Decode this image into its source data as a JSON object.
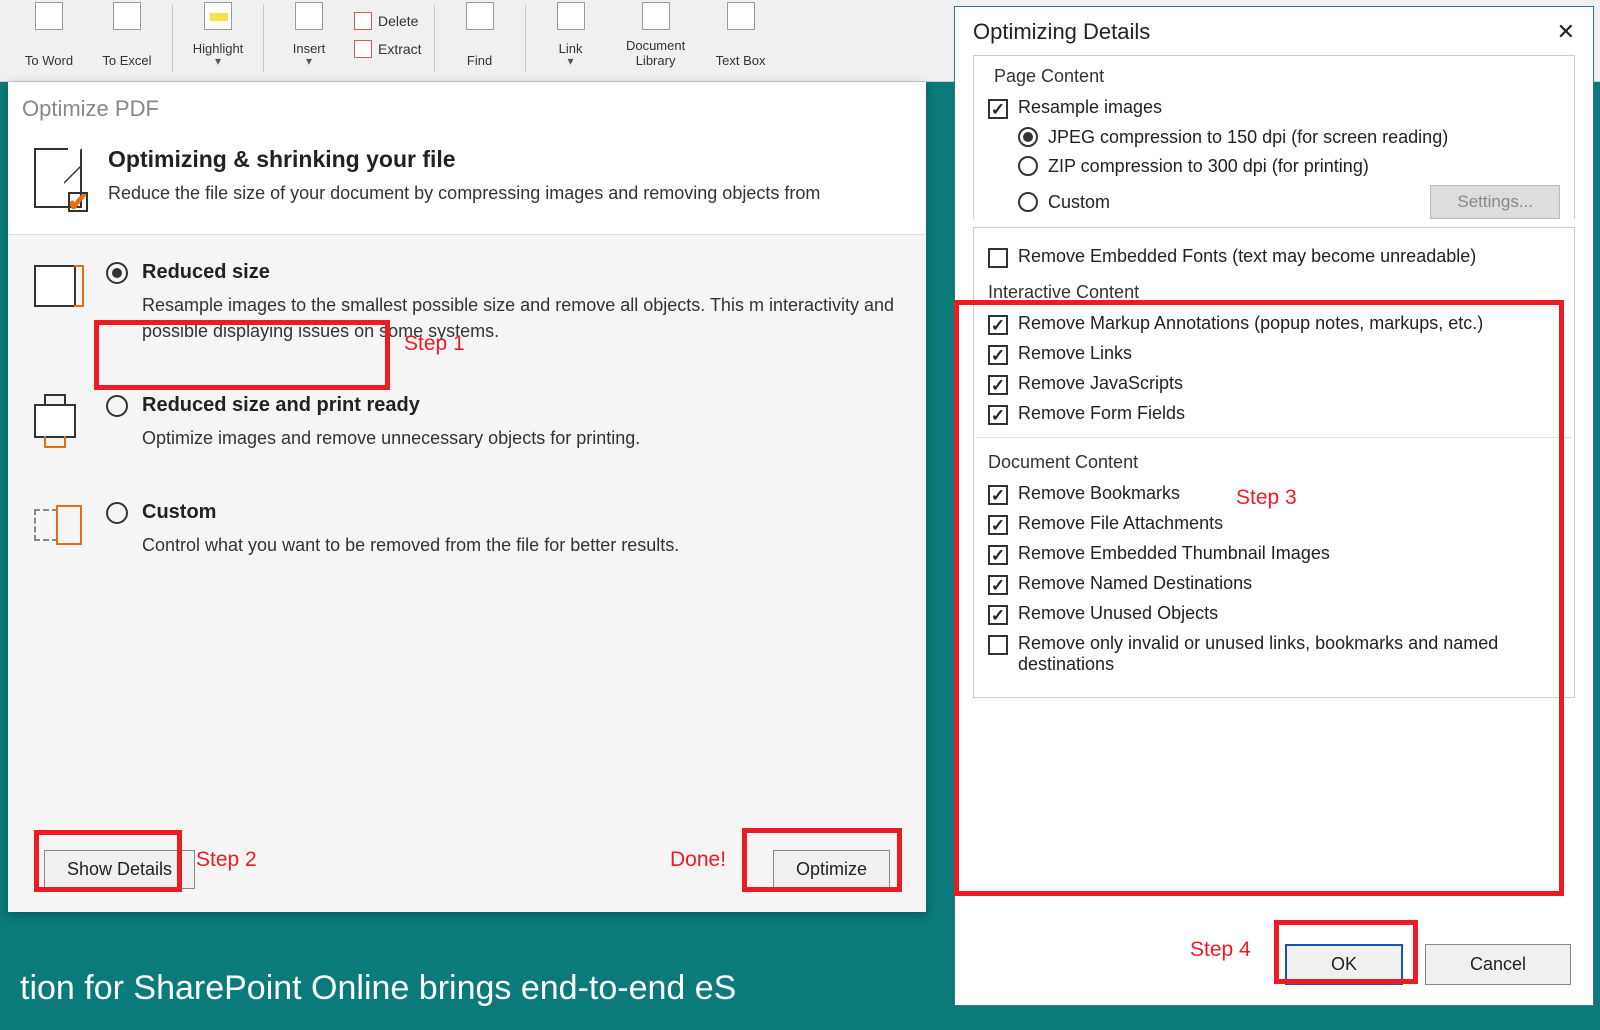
{
  "ribbon": {
    "to_word": "To Word",
    "to_excel": "To Excel",
    "highlight": "Highlight",
    "insert": "Insert",
    "delete": "Delete",
    "extract": "Extract",
    "find": "Find",
    "link": "Link",
    "doc_library": "Document Library",
    "text_box": "Text Box"
  },
  "panel": {
    "window_title": "Optimize PDF",
    "heading": "Optimizing & shrinking your file",
    "subheading": "Reduce the file size of your document by compressing images and removing objects from",
    "options": {
      "reduced": {
        "label": "Reduced size",
        "desc": "Resample images to the smallest possible size and remove all objects. This m interactivity and possible displaying issues on some systems."
      },
      "print": {
        "label": "Reduced size and print ready",
        "desc": "Optimize images and remove unnecessary objects for printing."
      },
      "custom": {
        "label": "Custom",
        "desc": "Control what you want to be removed from the file for better results."
      }
    },
    "show_details": "Show Details",
    "optimize": "Optimize"
  },
  "dialog": {
    "title": "Optimizing Details",
    "sections": {
      "page_content": "Page Content",
      "resample": "Resample images",
      "jpeg": "JPEG compression to 150 dpi (for screen reading)",
      "zip": "ZIP compression to 300 dpi (for printing)",
      "custom": "Custom",
      "settings": "Settings...",
      "remove_fonts": "Remove Embedded Fonts (text may become unreadable)",
      "interactive": "Interactive Content",
      "markup": "Remove Markup Annotations (popup notes, markups, etc.)",
      "links": "Remove Links",
      "js": "Remove JavaScripts",
      "form": "Remove Form Fields",
      "doc_content": "Document Content",
      "bookmarks": "Remove Bookmarks",
      "attachments": "Remove File Attachments",
      "thumbnails": "Remove Embedded Thumbnail Images",
      "named_dest": "Remove Named Destinations",
      "unused": "Remove Unused Objects",
      "invalid": "Remove only invalid or unused links, bookmarks and named destinations"
    },
    "ok": "OK",
    "cancel": "Cancel"
  },
  "annotations": {
    "step1": "Step 1",
    "step2": "Step 2",
    "step3": "Step 3",
    "step4": "Step 4",
    "done": "Done!"
  },
  "banner": "tion for SharePoint Online brings end-to-end eS"
}
